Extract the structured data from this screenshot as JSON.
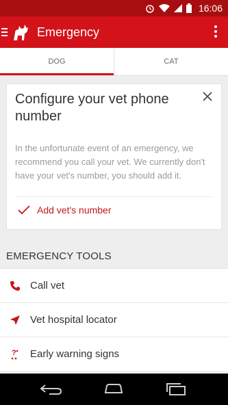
{
  "status_bar": {
    "time": "16:06"
  },
  "app_bar": {
    "title": "Emergency"
  },
  "tabs": [
    {
      "label": "DOG",
      "active": true
    },
    {
      "label": "CAT",
      "active": false
    }
  ],
  "card": {
    "title": "Configure your vet phone number",
    "body": "In the unfortunate event of an emergency, we recommend you call your vet. We currently don't have your vet's number, you should add it.",
    "action_label": "Add vet's number"
  },
  "section_title": "EMERGENCY TOOLS",
  "tools": [
    {
      "label": "Call vet",
      "icon": "phone-icon"
    },
    {
      "label": "Vet hospital locator",
      "icon": "navigation-arrow-icon"
    },
    {
      "label": "Early warning signs",
      "icon": "warning-signs-icon"
    }
  ],
  "colors": {
    "accent": "#d31219",
    "status_bar": "#a80e10"
  }
}
